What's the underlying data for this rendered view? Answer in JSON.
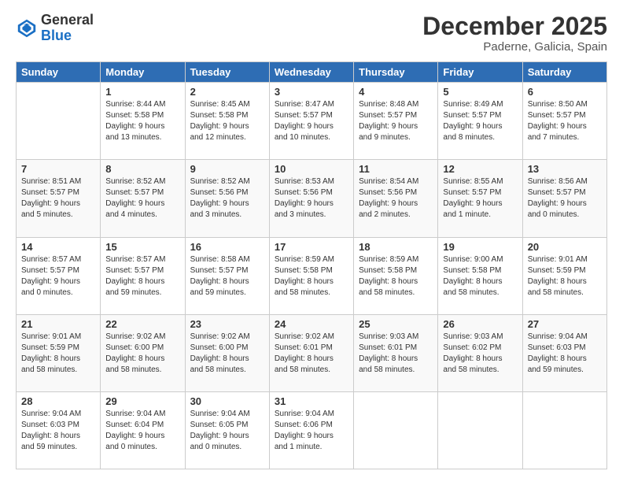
{
  "header": {
    "logo_line1": "General",
    "logo_line2": "Blue",
    "month": "December 2025",
    "location": "Paderne, Galicia, Spain"
  },
  "weekdays": [
    "Sunday",
    "Monday",
    "Tuesday",
    "Wednesday",
    "Thursday",
    "Friday",
    "Saturday"
  ],
  "weeks": [
    [
      {
        "day": "",
        "sunrise": "",
        "sunset": "",
        "daylight": ""
      },
      {
        "day": "1",
        "sunrise": "Sunrise: 8:44 AM",
        "sunset": "Sunset: 5:58 PM",
        "daylight": "Daylight: 9 hours and 13 minutes."
      },
      {
        "day": "2",
        "sunrise": "Sunrise: 8:45 AM",
        "sunset": "Sunset: 5:58 PM",
        "daylight": "Daylight: 9 hours and 12 minutes."
      },
      {
        "day": "3",
        "sunrise": "Sunrise: 8:47 AM",
        "sunset": "Sunset: 5:57 PM",
        "daylight": "Daylight: 9 hours and 10 minutes."
      },
      {
        "day": "4",
        "sunrise": "Sunrise: 8:48 AM",
        "sunset": "Sunset: 5:57 PM",
        "daylight": "Daylight: 9 hours and 9 minutes."
      },
      {
        "day": "5",
        "sunrise": "Sunrise: 8:49 AM",
        "sunset": "Sunset: 5:57 PM",
        "daylight": "Daylight: 9 hours and 8 minutes."
      },
      {
        "day": "6",
        "sunrise": "Sunrise: 8:50 AM",
        "sunset": "Sunset: 5:57 PM",
        "daylight": "Daylight: 9 hours and 7 minutes."
      }
    ],
    [
      {
        "day": "7",
        "sunrise": "Sunrise: 8:51 AM",
        "sunset": "Sunset: 5:57 PM",
        "daylight": "Daylight: 9 hours and 5 minutes."
      },
      {
        "day": "8",
        "sunrise": "Sunrise: 8:52 AM",
        "sunset": "Sunset: 5:57 PM",
        "daylight": "Daylight: 9 hours and 4 minutes."
      },
      {
        "day": "9",
        "sunrise": "Sunrise: 8:52 AM",
        "sunset": "Sunset: 5:56 PM",
        "daylight": "Daylight: 9 hours and 3 minutes."
      },
      {
        "day": "10",
        "sunrise": "Sunrise: 8:53 AM",
        "sunset": "Sunset: 5:56 PM",
        "daylight": "Daylight: 9 hours and 3 minutes."
      },
      {
        "day": "11",
        "sunrise": "Sunrise: 8:54 AM",
        "sunset": "Sunset: 5:56 PM",
        "daylight": "Daylight: 9 hours and 2 minutes."
      },
      {
        "day": "12",
        "sunrise": "Sunrise: 8:55 AM",
        "sunset": "Sunset: 5:57 PM",
        "daylight": "Daylight: 9 hours and 1 minute."
      },
      {
        "day": "13",
        "sunrise": "Sunrise: 8:56 AM",
        "sunset": "Sunset: 5:57 PM",
        "daylight": "Daylight: 9 hours and 0 minutes."
      }
    ],
    [
      {
        "day": "14",
        "sunrise": "Sunrise: 8:57 AM",
        "sunset": "Sunset: 5:57 PM",
        "daylight": "Daylight: 9 hours and 0 minutes."
      },
      {
        "day": "15",
        "sunrise": "Sunrise: 8:57 AM",
        "sunset": "Sunset: 5:57 PM",
        "daylight": "Daylight: 8 hours and 59 minutes."
      },
      {
        "day": "16",
        "sunrise": "Sunrise: 8:58 AM",
        "sunset": "Sunset: 5:57 PM",
        "daylight": "Daylight: 8 hours and 59 minutes."
      },
      {
        "day": "17",
        "sunrise": "Sunrise: 8:59 AM",
        "sunset": "Sunset: 5:58 PM",
        "daylight": "Daylight: 8 hours and 58 minutes."
      },
      {
        "day": "18",
        "sunrise": "Sunrise: 8:59 AM",
        "sunset": "Sunset: 5:58 PM",
        "daylight": "Daylight: 8 hours and 58 minutes."
      },
      {
        "day": "19",
        "sunrise": "Sunrise: 9:00 AM",
        "sunset": "Sunset: 5:58 PM",
        "daylight": "Daylight: 8 hours and 58 minutes."
      },
      {
        "day": "20",
        "sunrise": "Sunrise: 9:01 AM",
        "sunset": "Sunset: 5:59 PM",
        "daylight": "Daylight: 8 hours and 58 minutes."
      }
    ],
    [
      {
        "day": "21",
        "sunrise": "Sunrise: 9:01 AM",
        "sunset": "Sunset: 5:59 PM",
        "daylight": "Daylight: 8 hours and 58 minutes."
      },
      {
        "day": "22",
        "sunrise": "Sunrise: 9:02 AM",
        "sunset": "Sunset: 6:00 PM",
        "daylight": "Daylight: 8 hours and 58 minutes."
      },
      {
        "day": "23",
        "sunrise": "Sunrise: 9:02 AM",
        "sunset": "Sunset: 6:00 PM",
        "daylight": "Daylight: 8 hours and 58 minutes."
      },
      {
        "day": "24",
        "sunrise": "Sunrise: 9:02 AM",
        "sunset": "Sunset: 6:01 PM",
        "daylight": "Daylight: 8 hours and 58 minutes."
      },
      {
        "day": "25",
        "sunrise": "Sunrise: 9:03 AM",
        "sunset": "Sunset: 6:01 PM",
        "daylight": "Daylight: 8 hours and 58 minutes."
      },
      {
        "day": "26",
        "sunrise": "Sunrise: 9:03 AM",
        "sunset": "Sunset: 6:02 PM",
        "daylight": "Daylight: 8 hours and 58 minutes."
      },
      {
        "day": "27",
        "sunrise": "Sunrise: 9:04 AM",
        "sunset": "Sunset: 6:03 PM",
        "daylight": "Daylight: 8 hours and 59 minutes."
      }
    ],
    [
      {
        "day": "28",
        "sunrise": "Sunrise: 9:04 AM",
        "sunset": "Sunset: 6:03 PM",
        "daylight": "Daylight: 8 hours and 59 minutes."
      },
      {
        "day": "29",
        "sunrise": "Sunrise: 9:04 AM",
        "sunset": "Sunset: 6:04 PM",
        "daylight": "Daylight: 9 hours and 0 minutes."
      },
      {
        "day": "30",
        "sunrise": "Sunrise: 9:04 AM",
        "sunset": "Sunset: 6:05 PM",
        "daylight": "Daylight: 9 hours and 0 minutes."
      },
      {
        "day": "31",
        "sunrise": "Sunrise: 9:04 AM",
        "sunset": "Sunset: 6:06 PM",
        "daylight": "Daylight: 9 hours and 1 minute."
      },
      {
        "day": "",
        "sunrise": "",
        "sunset": "",
        "daylight": ""
      },
      {
        "day": "",
        "sunrise": "",
        "sunset": "",
        "daylight": ""
      },
      {
        "day": "",
        "sunrise": "",
        "sunset": "",
        "daylight": ""
      }
    ]
  ]
}
